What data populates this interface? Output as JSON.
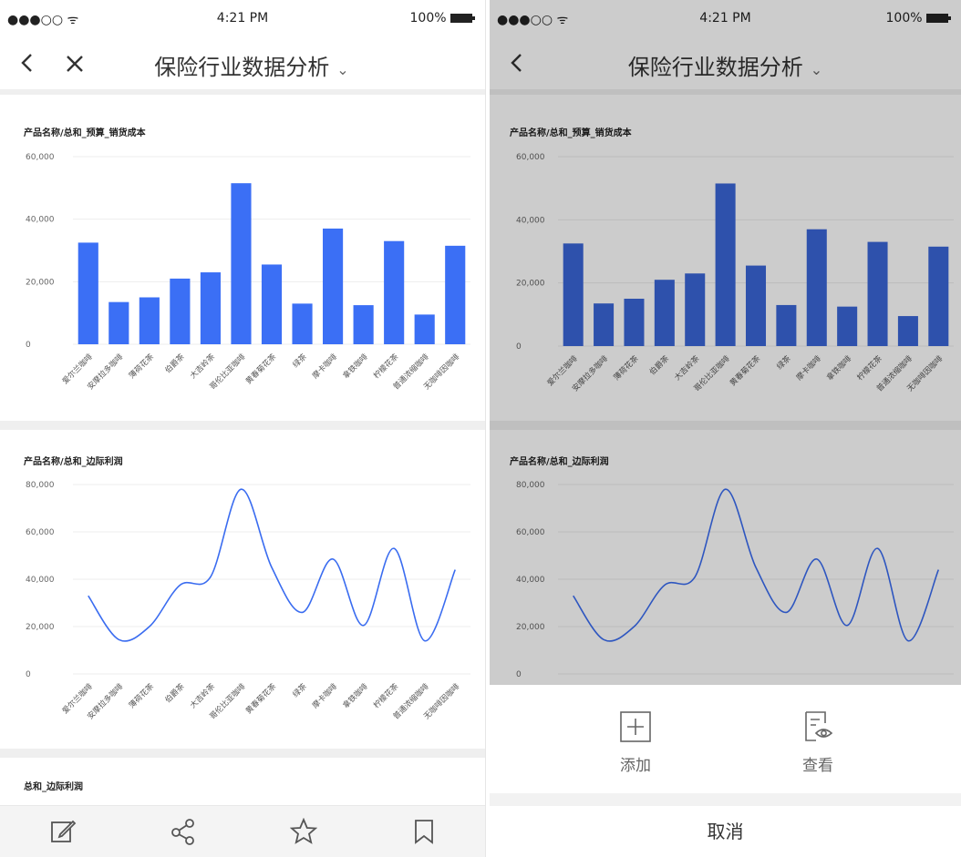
{
  "status": {
    "signal": "●●●○○ ᯤ",
    "time": "4:21 PM",
    "battery": "100%"
  },
  "nav": {
    "title": "保险行业数据分析",
    "chevron": "⌄"
  },
  "colors": {
    "bar": "#3b6ff5",
    "bar_dim": "#3a66d8",
    "line": "#3a6cf0",
    "overlay": "rgba(0,0,0,0.20)"
  },
  "chart_data": [
    {
      "type": "bar",
      "title": "产品名称/总和_预算_销货成本",
      "categories": [
        "爱尔兰咖啡",
        "安摩拉多咖啡",
        "薄荷花茶",
        "伯爵茶",
        "大吉岭茶",
        "哥伦比亚咖啡",
        "黄春菊花茶",
        "绿茶",
        "摩卡咖啡",
        "拿铁咖啡",
        "柠檬花茶",
        "普通浓缩咖啡",
        "无咖啡因咖啡"
      ],
      "values": [
        32500,
        13500,
        15000,
        21000,
        23000,
        51500,
        25500,
        13000,
        37000,
        12500,
        33000,
        9500,
        31500
      ],
      "ylim": [
        0,
        60000
      ],
      "yticks": [
        "60,000",
        "40,000",
        "20,000",
        "0"
      ],
      "grid": true
    },
    {
      "type": "line",
      "title": "产品名称/总和_边际利润",
      "categories": [
        "爱尔兰咖啡",
        "安摩拉多咖啡",
        "薄荷花茶",
        "伯爵茶",
        "大吉岭茶",
        "哥伦比亚咖啡",
        "黄春菊花茶",
        "绿茶",
        "摩卡咖啡",
        "拿铁咖啡",
        "柠檬花茶",
        "普通浓缩咖啡",
        "无咖啡因咖啡"
      ],
      "values": [
        33000,
        14500,
        20000,
        37500,
        41000,
        78000,
        45000,
        26000,
        48500,
        20500,
        53000,
        14000,
        44000
      ],
      "ylim": [
        0,
        80000
      ],
      "yticks": [
        "80,000",
        "60,000",
        "40,000",
        "20,000",
        "0"
      ],
      "grid": true
    }
  ],
  "third_chart_title": "总和_边际利润",
  "toolbar": {
    "icons": [
      "edit-icon",
      "share-icon",
      "star-icon",
      "bookmark-icon"
    ]
  },
  "sheet": {
    "add_label": "添加",
    "view_label": "查看",
    "cancel_label": "取消"
  }
}
